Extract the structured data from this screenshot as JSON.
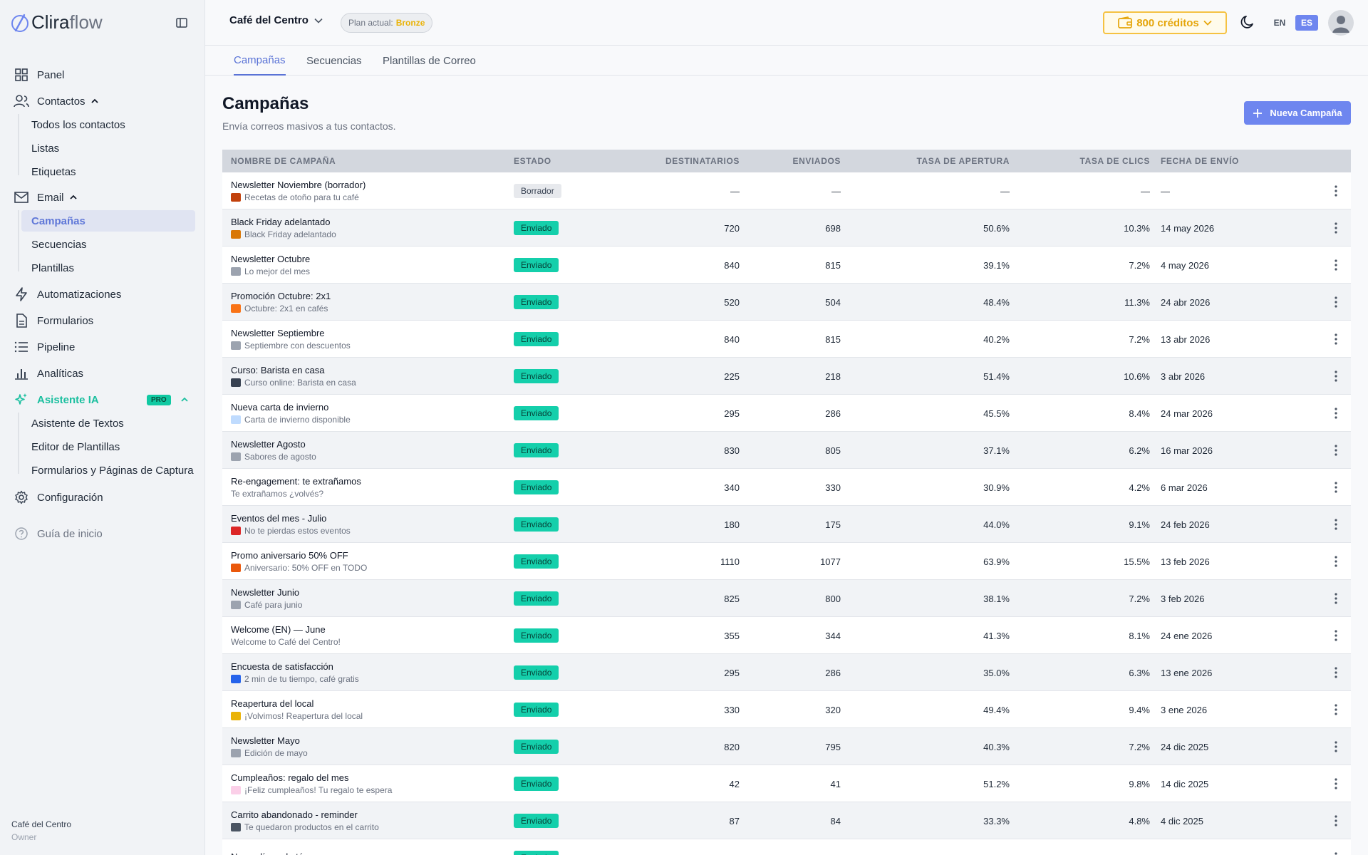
{
  "brand": {
    "prefix": "Clira",
    "suffix": "flow"
  },
  "sidebar": {
    "items": {
      "panel": "Panel",
      "contacts": "Contactos",
      "contacts_sub": [
        "Todos los contactos",
        "Listas",
        "Etiquetas"
      ],
      "email": "Email",
      "email_sub": [
        "Campañas",
        "Secuencias",
        "Plantillas"
      ],
      "automations": "Automatizaciones",
      "forms": "Formularios",
      "pipeline": "Pipeline",
      "analytics": "Analíticas",
      "ai": "Asistente IA",
      "ai_badge": "PRO",
      "ai_sub": [
        "Asistente de Textos",
        "Editor de Plantillas",
        "Formularios y Páginas de Captura"
      ],
      "settings": "Configuración",
      "guide": "Guía de inicio"
    },
    "footer": {
      "org": "Café del Centro",
      "role": "Owner"
    }
  },
  "topbar": {
    "org_name": "Café del Centro",
    "plan_label": "Plan actual:",
    "plan_name": "Bronze",
    "credits": "800 créditos",
    "lang_en": "EN",
    "lang_es": "ES"
  },
  "tabs": [
    "Campañas",
    "Secuencias",
    "Plantillas de Correo"
  ],
  "header": {
    "title": "Campañas",
    "subtitle": "Envía correos masivos a tus contactos.",
    "new_button": "Nueva Campaña"
  },
  "table": {
    "columns": [
      "NOMBRE DE CAMPAÑA",
      "ESTADO",
      "DESTINATARIOS",
      "ENVIADOS",
      "TASA DE APERTURA",
      "TASA DE CLICS",
      "FECHA DE ENVÍO"
    ],
    "rows": [
      {
        "name": "Newsletter Noviembre (borrador)",
        "subject": "Recetas de otoño para tu café",
        "emoji_color": "#c2410c",
        "status": "Borrador",
        "recipients": "—",
        "sent": "—",
        "open": "—",
        "clicks": "—",
        "date": "—"
      },
      {
        "name": "Black Friday adelantado",
        "subject": "Black Friday adelantado",
        "emoji_color": "#d97706",
        "status": "Enviado",
        "recipients": "720",
        "sent": "698",
        "open": "50.6%",
        "clicks": "10.3%",
        "date": "14 may 2026"
      },
      {
        "name": "Newsletter Octubre",
        "subject": "Lo mejor del mes",
        "emoji_color": "#9ca3af",
        "status": "Enviado",
        "recipients": "840",
        "sent": "815",
        "open": "39.1%",
        "clicks": "7.2%",
        "date": "4 may 2026"
      },
      {
        "name": "Promoción Octubre: 2x1",
        "subject": "Octubre: 2x1 en cafés",
        "emoji_color": "#f97316",
        "status": "Enviado",
        "recipients": "520",
        "sent": "504",
        "open": "48.4%",
        "clicks": "11.3%",
        "date": "24 abr 2026"
      },
      {
        "name": "Newsletter Septiembre",
        "subject": "Septiembre con descuentos",
        "emoji_color": "#9ca3af",
        "status": "Enviado",
        "recipients": "840",
        "sent": "815",
        "open": "40.2%",
        "clicks": "7.2%",
        "date": "13 abr 2026"
      },
      {
        "name": "Curso: Barista en casa",
        "subject": "Curso online: Barista en casa",
        "emoji_color": "#374151",
        "status": "Enviado",
        "recipients": "225",
        "sent": "218",
        "open": "51.4%",
        "clicks": "10.6%",
        "date": "3 abr 2026"
      },
      {
        "name": "Nueva carta de invierno",
        "subject": "Carta de invierno disponible",
        "emoji_color": "#bfdbfe",
        "status": "Enviado",
        "recipients": "295",
        "sent": "286",
        "open": "45.5%",
        "clicks": "8.4%",
        "date": "24 mar 2026"
      },
      {
        "name": "Newsletter Agosto",
        "subject": "Sabores de agosto",
        "emoji_color": "#9ca3af",
        "status": "Enviado",
        "recipients": "830",
        "sent": "805",
        "open": "37.1%",
        "clicks": "6.2%",
        "date": "16 mar 2026"
      },
      {
        "name": "Re-engagement: te extrañamos",
        "subject": "Te extrañamos ¿volvés?",
        "emoji_color": "",
        "status": "Enviado",
        "recipients": "340",
        "sent": "330",
        "open": "30.9%",
        "clicks": "4.2%",
        "date": "6 mar 2026"
      },
      {
        "name": "Eventos del mes - Julio",
        "subject": "No te pierdas estos eventos",
        "emoji_color": "#dc2626",
        "status": "Enviado",
        "recipients": "180",
        "sent": "175",
        "open": "44.0%",
        "clicks": "9.1%",
        "date": "24 feb 2026"
      },
      {
        "name": "Promo aniversario 50% OFF",
        "subject": "Aniversario: 50% OFF en TODO",
        "emoji_color": "#ea580c",
        "status": "Enviado",
        "recipients": "1110",
        "sent": "1077",
        "open": "63.9%",
        "clicks": "15.5%",
        "date": "13 feb 2026"
      },
      {
        "name": "Newsletter Junio",
        "subject": "Café para junio",
        "emoji_color": "#9ca3af",
        "status": "Enviado",
        "recipients": "825",
        "sent": "800",
        "open": "38.1%",
        "clicks": "7.2%",
        "date": "3 feb 2026"
      },
      {
        "name": "Welcome (EN) — June",
        "subject": "Welcome to Café del Centro!",
        "emoji_color": "",
        "status": "Enviado",
        "recipients": "355",
        "sent": "344",
        "open": "41.3%",
        "clicks": "8.1%",
        "date": "24 ene 2026"
      },
      {
        "name": "Encuesta de satisfacción",
        "subject": "2 min de tu tiempo, café gratis",
        "emoji_color": "#2563eb",
        "status": "Enviado",
        "recipients": "295",
        "sent": "286",
        "open": "35.0%",
        "clicks": "6.3%",
        "date": "13 ene 2026"
      },
      {
        "name": "Reapertura del local",
        "subject": "¡Volvimos! Reapertura del local",
        "emoji_color": "#eab308",
        "status": "Enviado",
        "recipients": "330",
        "sent": "320",
        "open": "49.4%",
        "clicks": "9.4%",
        "date": "3 ene 2026"
      },
      {
        "name": "Newsletter Mayo",
        "subject": "Edición de mayo",
        "emoji_color": "#9ca3af",
        "status": "Enviado",
        "recipients": "820",
        "sent": "795",
        "open": "40.3%",
        "clicks": "7.2%",
        "date": "24 dic 2025"
      },
      {
        "name": "Cumpleaños: regalo del mes",
        "subject": "¡Feliz cumpleaños! Tu regalo te espera",
        "emoji_color": "#fbcfe8",
        "status": "Enviado",
        "recipients": "42",
        "sent": "41",
        "open": "51.2%",
        "clicks": "9.8%",
        "date": "14 dic 2025"
      },
      {
        "name": "Carrito abandonado - reminder",
        "subject": "Te quedaron productos en el carrito",
        "emoji_color": "#4b5563",
        "status": "Enviado",
        "recipients": "87",
        "sent": "84",
        "open": "33.3%",
        "clicks": "4.8%",
        "date": "4 dic 2025"
      },
      {
        "name": "Nueva línea de tés",
        "subject": "",
        "emoji_color": "",
        "status": "Enviado",
        "recipients": "",
        "sent": "",
        "open": "",
        "clicks": "",
        "date": ""
      }
    ]
  },
  "colors": {
    "accent": "#6e86ef",
    "sent_badge": "#14cfab",
    "credits": "#e5a50a",
    "ai": "#1bbf9f"
  }
}
